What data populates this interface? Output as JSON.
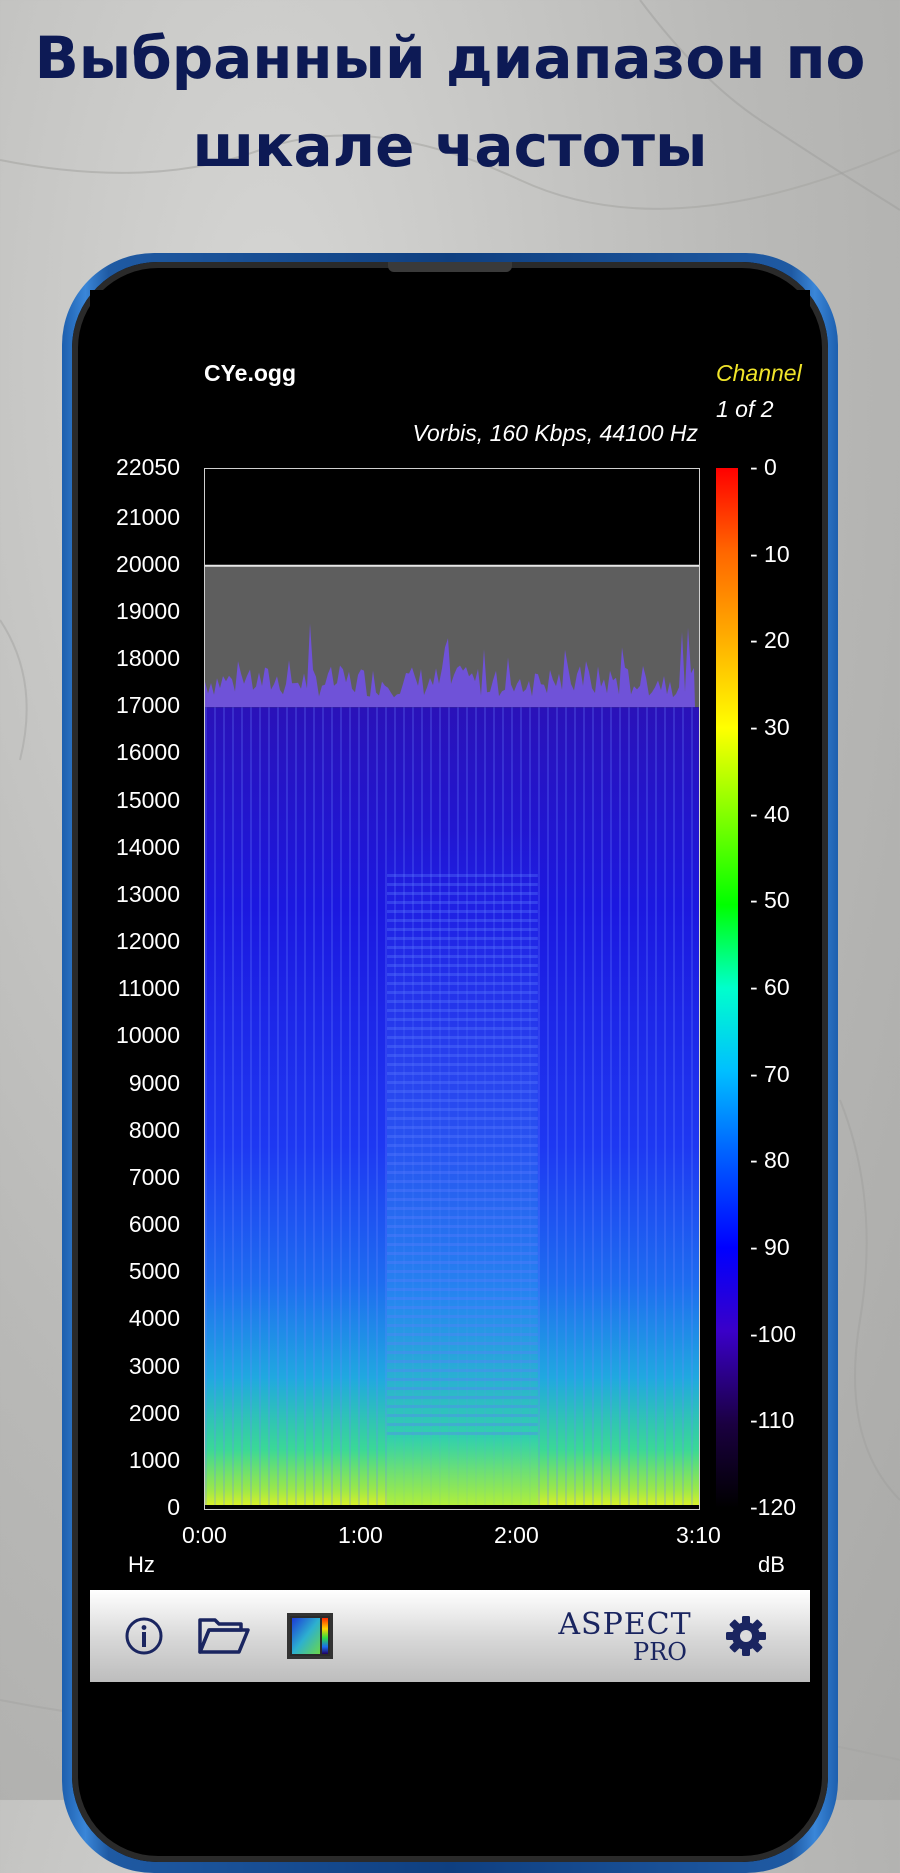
{
  "headline": {
    "line1": "Выбранный диапазон по",
    "line2": "шкале частоты"
  },
  "file": {
    "name": "CYe.ogg",
    "codec_info": "Vorbis, 160 Kbps, 44100 Hz"
  },
  "channel": {
    "label": "Channel",
    "value": "1 of 2"
  },
  "spectrogram": {
    "y_ticks": [
      "22050",
      "21000",
      "20000",
      "19000",
      "18000",
      "17000",
      "16000",
      "15000",
      "14000",
      "13000",
      "12000",
      "11000",
      "10000",
      "9000",
      "8000",
      "7000",
      "6000",
      "5000",
      "4000",
      "3000",
      "2000",
      "1000",
      "0"
    ],
    "x_ticks": [
      "0:00",
      "1:00",
      "2:00",
      "3:10"
    ],
    "y_unit": "Hz",
    "db_unit": "dB",
    "db_ticks": [
      "- 0",
      "- 10",
      "- 20",
      "- 30",
      "- 40",
      "- 50",
      "- 60",
      "- 70",
      "- 80",
      "- 90",
      "-100",
      "-110",
      "-120"
    ],
    "selected_range_hz": [
      17000,
      20000
    ],
    "max_hz": 22050,
    "duration_s": 190
  },
  "toolbar": {
    "logo_line1": "ASPECT",
    "logo_line2": "PRO",
    "icons": [
      "info-icon",
      "folder-open-icon",
      "colormap-icon",
      "gear-icon"
    ]
  },
  "colors": {
    "headline": "#0d1a55",
    "channel_label": "#f1e52a",
    "phone_frame": "#1f5aa3",
    "icon_navy": "#1a2560"
  }
}
